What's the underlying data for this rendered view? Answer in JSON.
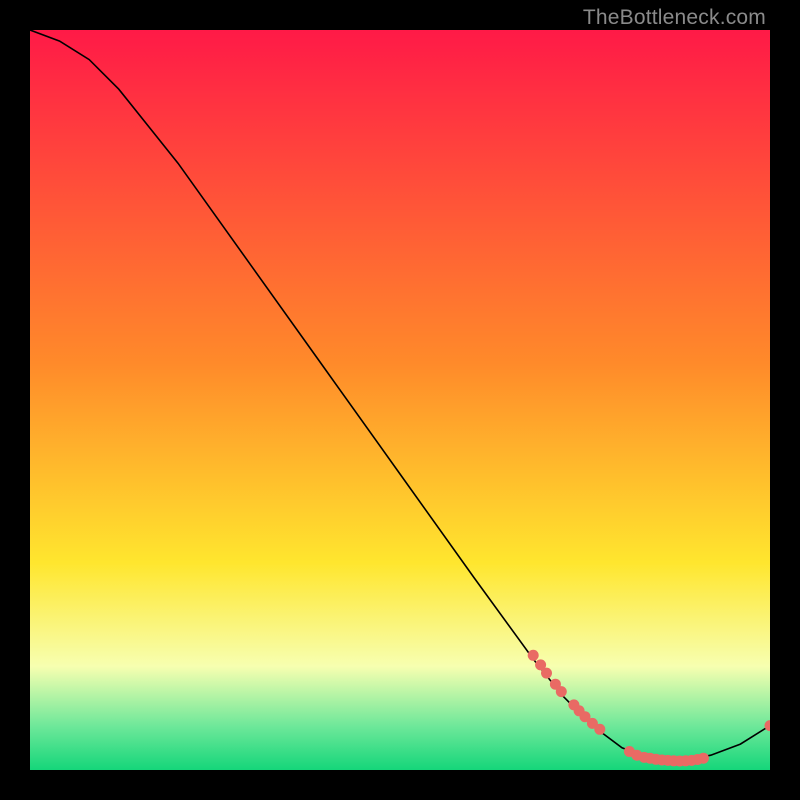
{
  "watermark": "TheBottleneck.com",
  "colors": {
    "dot": "#e96a64",
    "curve": "#000000",
    "gradient_top": "#ff1a47",
    "gradient_mid1": "#ff8a2a",
    "gradient_mid2": "#ffe62e",
    "gradient_low": "#f7ffb0",
    "gradient_bottom1": "#6fe89a",
    "gradient_bottom2": "#15d67a"
  },
  "chart_data": {
    "type": "line",
    "title": "",
    "xlabel": "",
    "ylabel": "",
    "xlim": [
      0,
      100
    ],
    "ylim": [
      0,
      100
    ],
    "curve": [
      {
        "x": 0,
        "y": 100
      },
      {
        "x": 4,
        "y": 98.5
      },
      {
        "x": 8,
        "y": 96
      },
      {
        "x": 12,
        "y": 92
      },
      {
        "x": 20,
        "y": 82
      },
      {
        "x": 30,
        "y": 68
      },
      {
        "x": 40,
        "y": 54
      },
      {
        "x": 50,
        "y": 40
      },
      {
        "x": 60,
        "y": 26
      },
      {
        "x": 68,
        "y": 15
      },
      {
        "x": 72,
        "y": 10
      },
      {
        "x": 76,
        "y": 6
      },
      {
        "x": 80,
        "y": 3
      },
      {
        "x": 84,
        "y": 1.5
      },
      {
        "x": 88,
        "y": 1.2
      },
      {
        "x": 92,
        "y": 2
      },
      {
        "x": 96,
        "y": 3.5
      },
      {
        "x": 100,
        "y": 6
      }
    ],
    "points": [
      {
        "x": 68,
        "y": 15.5
      },
      {
        "x": 69,
        "y": 14.2
      },
      {
        "x": 69.8,
        "y": 13.1
      },
      {
        "x": 71,
        "y": 11.6
      },
      {
        "x": 71.8,
        "y": 10.6
      },
      {
        "x": 73.5,
        "y": 8.8
      },
      {
        "x": 74.2,
        "y": 8.0
      },
      {
        "x": 75,
        "y": 7.2
      },
      {
        "x": 76,
        "y": 6.3
      },
      {
        "x": 77,
        "y": 5.5
      },
      {
        "x": 81,
        "y": 2.5
      },
      {
        "x": 82,
        "y": 2.0
      },
      {
        "x": 83,
        "y": 1.7
      },
      {
        "x": 83.8,
        "y": 1.6
      },
      {
        "x": 84.6,
        "y": 1.45
      },
      {
        "x": 85.4,
        "y": 1.35
      },
      {
        "x": 86.2,
        "y": 1.3
      },
      {
        "x": 87,
        "y": 1.25
      },
      {
        "x": 87.8,
        "y": 1.22
      },
      {
        "x": 88.6,
        "y": 1.25
      },
      {
        "x": 89.4,
        "y": 1.3
      },
      {
        "x": 90.2,
        "y": 1.42
      },
      {
        "x": 91,
        "y": 1.6
      },
      {
        "x": 100,
        "y": 6
      }
    ]
  }
}
